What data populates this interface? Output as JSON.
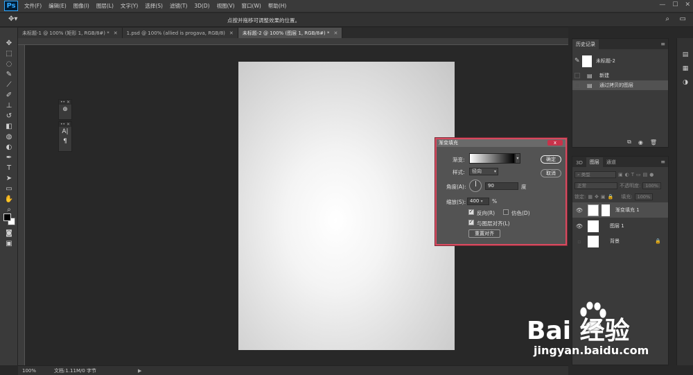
{
  "app": {
    "logo": "Ps"
  },
  "menu": [
    "文件(F)",
    "编辑(E)",
    "图像(I)",
    "图层(L)",
    "文字(Y)",
    "选择(S)",
    "滤镜(T)",
    "3D(D)",
    "视图(V)",
    "窗口(W)",
    "帮助(H)"
  ],
  "window_controls": {
    "minimize": "—",
    "maximize": "☐",
    "close": "✕"
  },
  "options_bar": {
    "hint": "点按并拖移可调整效果的位置。"
  },
  "tabs": [
    {
      "label": "未标题-1 @ 100% (矩形 1, RGB/8#) *",
      "active": false
    },
    {
      "label": "1.psd @ 100% (allied is progava, RGB/8)",
      "active": false
    },
    {
      "label": "未标题-2 @ 100% (图层 1, RGB/8#) *",
      "active": true
    }
  ],
  "status_bar": {
    "zoom": "100%",
    "doc_size": "文档:1.11M/0 字节",
    "arrow": "▶"
  },
  "history_panel": {
    "tab": "历史记录",
    "snapshot_label": "未标题-2",
    "items": [
      {
        "label": "新建",
        "active": false
      },
      {
        "label": "通过拷贝的图层",
        "active": true
      }
    ]
  },
  "layers_panel": {
    "tabs": [
      "3D",
      "图层",
      "通道"
    ],
    "active_tab": "图层",
    "kind_filter": "类型",
    "blend_mode": "正常",
    "opacity_label": "不透明度:",
    "opacity_value": "100%",
    "lock_label": "锁定:",
    "fill_label": "填充:",
    "fill_value": "100%",
    "layers": [
      {
        "name": "渐变填充 1",
        "active": true,
        "visible": true
      },
      {
        "name": "图层 1",
        "active": false,
        "visible": true
      },
      {
        "name": "背景",
        "active": false,
        "visible": false
      }
    ]
  },
  "dialog": {
    "title": "渐变填充",
    "close": "x",
    "gradient_label": "渐变:",
    "style_label": "样式:",
    "style_value": "径向",
    "angle_label": "角度(A):",
    "angle_value": "90",
    "angle_unit": "度",
    "scale_label": "缩放(S):",
    "scale_value": "400",
    "scale_unit": "%",
    "reverse_label": "反向(R)",
    "reverse_checked": true,
    "dither_label": "仿色(D)",
    "dither_checked": false,
    "align_label": "与图层对齐(L)",
    "align_checked": true,
    "reset_label": "重置对齐",
    "ok_label": "确定",
    "cancel_label": "取消"
  },
  "watermark": {
    "logo": "Bai 经验",
    "url": "jingyan.baidu.com"
  }
}
